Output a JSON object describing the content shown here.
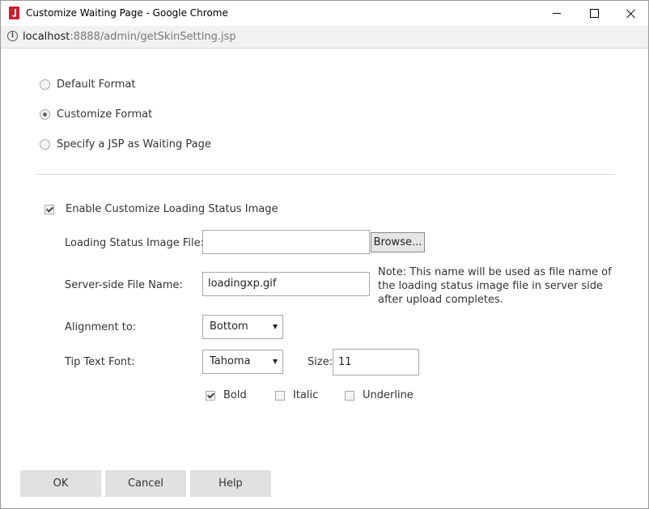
{
  "window": {
    "title": "Customize Waiting Page - Google Chrome",
    "url_host": "localhost",
    "url_path": ":8888/admin/getSkinSetting.jsp"
  },
  "format_options": [
    {
      "label": "Default Format",
      "selected": false
    },
    {
      "label": "Customize Format",
      "selected": true
    },
    {
      "label": "Specify a JSP as Waiting Page",
      "selected": false
    }
  ],
  "loading_image": {
    "enable_label": "Enable Customize Loading Status Image",
    "enabled": true,
    "file_label": "Loading Status Image File:",
    "file_value": "",
    "browse_label": "Browse...",
    "server_name_label": "Server-side File Name:",
    "server_name_value": "loadingxp.gif",
    "note": "Note: This name will be used as file name of the loading status image file in server side after upload completes.",
    "alignment_label": "Alignment to:",
    "alignment_value": "Bottom",
    "font_label": "Tip Text Font:",
    "font_value": "Tahoma",
    "size_label": "Size:",
    "size_value": "11",
    "bold_label": "Bold",
    "bold": true,
    "italic_label": "Italic",
    "italic": false,
    "underline_label": "Underline",
    "underline": false
  },
  "footer": {
    "ok_label": "OK",
    "cancel_label": "Cancel",
    "help_label": "Help"
  }
}
